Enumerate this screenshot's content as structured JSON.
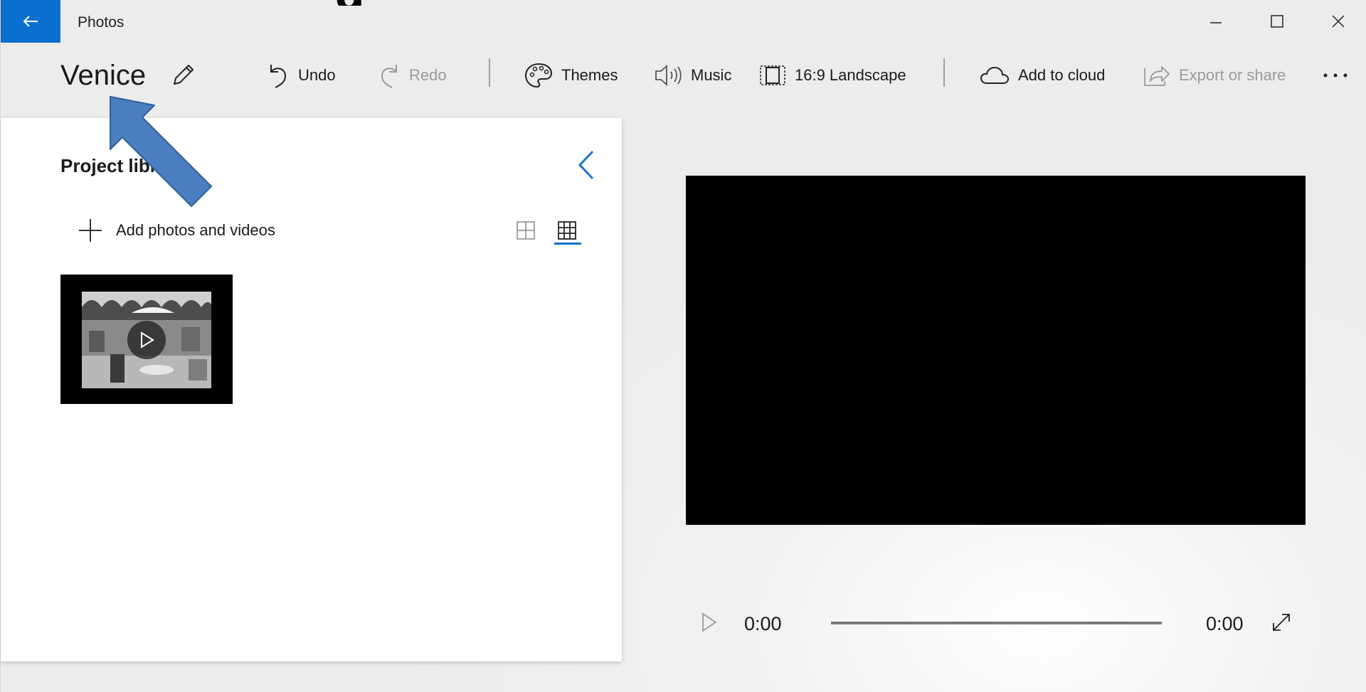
{
  "app": {
    "title": "Photos",
    "accent_color": "#0a6fd0"
  },
  "slide_fragment": {
    "text": "g"
  },
  "title_bar": {
    "back_icon": "back-arrow-icon",
    "controls": [
      "minimize-icon",
      "maximize-icon",
      "close-icon"
    ]
  },
  "toolbar": {
    "project_title": "Venice",
    "edit_icon": "pencil-icon",
    "undo_label": "Undo",
    "redo_label": "Redo",
    "themes_label": "Themes",
    "music_label": "Music",
    "aspect_label": "16:9 Landscape",
    "cloud_label": "Add to cloud",
    "export_label": "Export or share",
    "more_icon": "more-icon"
  },
  "library": {
    "title": "Project library",
    "add_label": "Add photos and videos",
    "views": [
      "large-grid-icon",
      "small-grid-icon"
    ],
    "selected_view": "small-grid-icon",
    "items": [
      {
        "type": "video",
        "name": "video-thumbnail"
      }
    ]
  },
  "player": {
    "current_time": "0:00",
    "total_time": "0:00",
    "progress": 0
  },
  "annotation": {
    "icon": "annotation-arrow-icon",
    "color": "#4a7ebf"
  }
}
